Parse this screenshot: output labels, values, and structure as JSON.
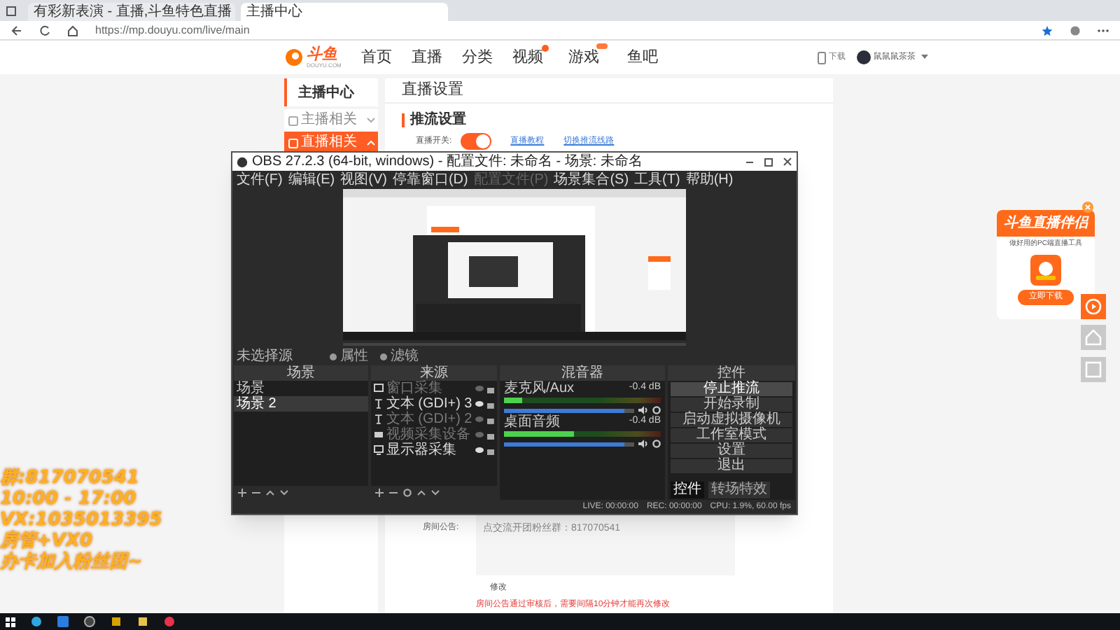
{
  "browser": {
    "tabs": [
      {
        "title": "有彩新表演 - 直播,斗鱼特色直播",
        "selected": false
      },
      {
        "title": "主播中心",
        "selected": true
      }
    ],
    "url": "https://mp.douyu.com/live/main"
  },
  "site_header": {
    "logo": {
      "text": "斗鱼",
      "sub": "DOUYU.COM"
    },
    "nav": [
      {
        "label": "首页",
        "kind": "plain"
      },
      {
        "label": "直播",
        "kind": "plain"
      },
      {
        "label": "分类",
        "kind": "plain"
      },
      {
        "label": "视频",
        "kind": "dot"
      },
      {
        "label": "游戏",
        "kind": "tag"
      },
      {
        "label": "鱼吧",
        "kind": "plain"
      }
    ],
    "download": "下载",
    "username": "鼠鼠鼠茶茶"
  },
  "sidebar": {
    "title": "主播中心",
    "items": [
      {
        "label": "主播相关",
        "selected": false,
        "expanded": false
      },
      {
        "label": "直播相关",
        "selected": true,
        "expanded": true
      }
    ]
  },
  "main": {
    "title": "直播设置",
    "section": "推流设置",
    "switch": {
      "label": "直播开关:",
      "on": true
    },
    "links": [
      "直播教程",
      "切换推流线路"
    ],
    "notice": {
      "label": "房间公告:",
      "value": "点交流开团粉丝群：817070541",
      "button": "修改",
      "hint": "房间公告通过审核后，需要间隔10分钟才能再次修改"
    }
  },
  "obs": {
    "title": "OBS 27.2.3 (64-bit, windows) - 配置文件: 未命名 - 场景: 未命名",
    "menu": [
      {
        "label": "文件(F)",
        "disabled": false
      },
      {
        "label": "编辑(E)",
        "disabled": false
      },
      {
        "label": "视图(V)",
        "disabled": false
      },
      {
        "label": "停靠窗口(D)",
        "disabled": false
      },
      {
        "label": "配置文件(P)",
        "disabled": true
      },
      {
        "label": "场景集合(S)",
        "disabled": false
      },
      {
        "label": "工具(T)",
        "disabled": false
      },
      {
        "label": "帮助(H)",
        "disabled": false
      }
    ],
    "source_bar": {
      "label": "未选择源",
      "buttons": [
        "属性",
        "滤镜"
      ]
    },
    "docks": {
      "scenes": "场景",
      "sources": "来源",
      "mixer": "混音器",
      "controls": "控件"
    },
    "scenes": [
      {
        "label": "场景",
        "selected": false
      },
      {
        "label": "场景 2",
        "selected": true
      }
    ],
    "sources": [
      {
        "label": "窗口采集",
        "kind": "window",
        "visible": false
      },
      {
        "label": "文本 (GDI+) 3",
        "kind": "text",
        "visible": true
      },
      {
        "label": "文本 (GDI+) 2",
        "kind": "text",
        "visible": false
      },
      {
        "label": "视频采集设备",
        "kind": "camera",
        "visible": false
      },
      {
        "label": "显示器采集",
        "kind": "display",
        "visible": true
      }
    ],
    "channels": [
      {
        "name": "麦克风/Aux",
        "reading": "-0.4 dB",
        "meter": {
          "level": 0.12
        },
        "level": 0.92
      },
      {
        "name": "桌面音频",
        "reading": "-0.4 dB",
        "meter": {
          "level": 0.45
        },
        "level": 0.92
      }
    ],
    "controls": [
      {
        "label": "停止推流",
        "selected": true
      },
      {
        "label": "开始录制",
        "selected": false
      },
      {
        "label": "启动虚拟摄像机",
        "selected": false
      },
      {
        "label": "工作室模式",
        "selected": false
      },
      {
        "label": "设置",
        "selected": false
      },
      {
        "label": "退出",
        "selected": false
      }
    ],
    "bottom_tabs": [
      {
        "label": "控件",
        "selected": true
      },
      {
        "label": "转场特效",
        "selected": false
      }
    ],
    "status": [
      "LIVE: 00:00:00",
      "REC: 00:00:00",
      "CPU: 1.9%, 60.00 fps"
    ]
  },
  "overlay_lines": [
    "群:817070541",
    "10:00 - 17:00",
    "VX:1035013395",
    "房管+VX0",
    "办卡加入粉丝团~"
  ],
  "promo": {
    "title": "斗鱼直播伴侣",
    "subtitle": "做好用的PC端直播工具",
    "button": "立即下载"
  }
}
